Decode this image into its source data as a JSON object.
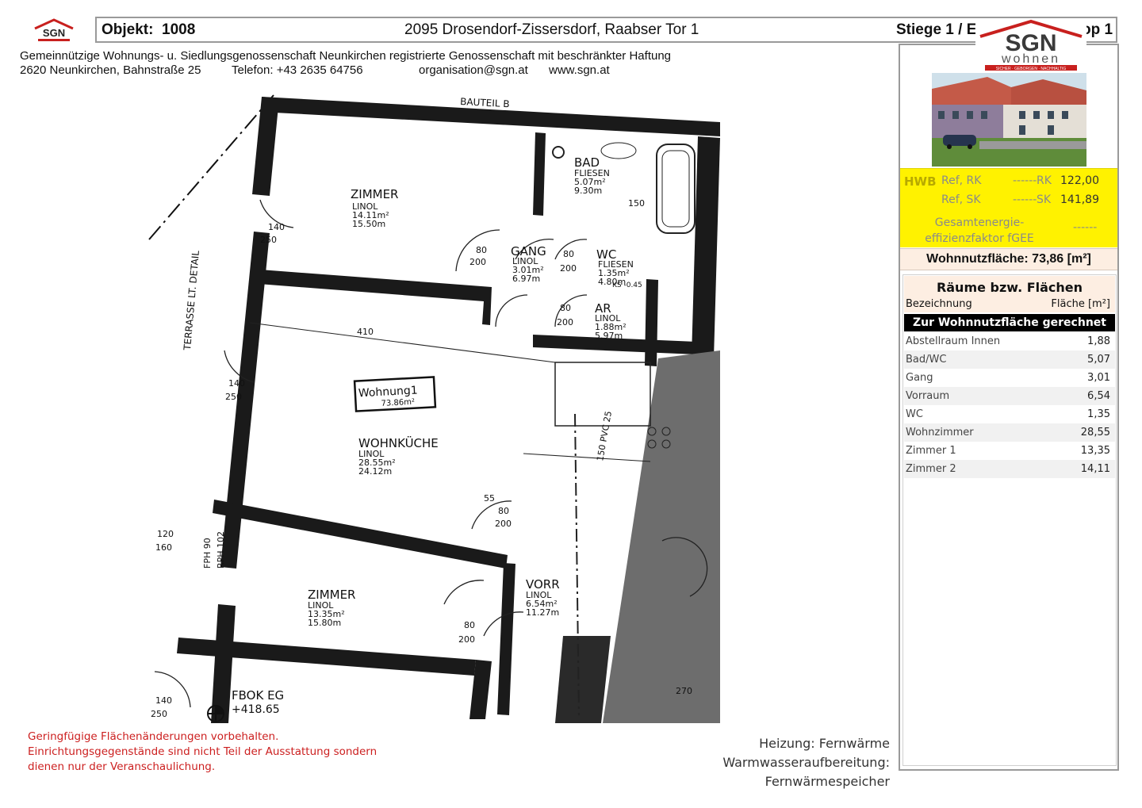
{
  "header": {
    "logo_small_text": "SGN",
    "objekt_label": "Objekt:",
    "objekt_number": "1008",
    "address": "2095 Drosendorf-Zissersdorf, Raabser Tor 1",
    "stiege": "Stiege 1 / Erdgeschoss / Top 1"
  },
  "company": {
    "name": "Gemeinnützige Wohnungs- u. Siedlungsgenossenschaft Neunkirchen registrierte Genossenschaft mit beschränkter Haftung",
    "street": "2620 Neunkirchen, Bahnstraße 25",
    "phone": "Telefon: +43 2635 64756",
    "email": "organisation@sgn.at",
    "web": "www.sgn.at"
  },
  "brand": {
    "logo_text": "SGN",
    "logo_sub": "wohnen",
    "logo_tagline": "SICHER · GEBORGEN · NACHHALTIG",
    "red": "#c8201e",
    "yellow": "#fff200"
  },
  "energy": {
    "hwb_label": "HWB",
    "ref_rk_label": "Ref, RK",
    "ref_rk_value": "------",
    "rk_label": "RK",
    "rk_value": "122,00",
    "ref_sk_label": "Ref, SK",
    "ref_sk_value": "------",
    "sk_label": "SK",
    "sk_value": "141,89",
    "fgee_line1": "Gesamtenergie-",
    "fgee_line2": "effizienzfaktor fGEE",
    "fgee_value": "------"
  },
  "wohnnutzflaeche": "Wohnnutzfläche: 73,86 [m²]",
  "rooms": {
    "title": "Räume bzw. Flächen",
    "col_name": "Bezeichnung",
    "col_area": "Fläche [m²]",
    "section": "Zur Wohnnutzfläche gerechnet",
    "items": [
      {
        "name": "Abstellraum Innen",
        "area": "1,88"
      },
      {
        "name": "Bad/WC",
        "area": "5,07"
      },
      {
        "name": "Gang",
        "area": "3,01"
      },
      {
        "name": "Vorraum",
        "area": "6,54"
      },
      {
        "name": "WC",
        "area": "1,35"
      },
      {
        "name": "Wohnzimmer",
        "area": "28,55"
      },
      {
        "name": "Zimmer 1",
        "area": "13,35"
      },
      {
        "name": "Zimmer 2",
        "area": "14,11"
      }
    ]
  },
  "plan": {
    "bauteil": "BAUTEIL B",
    "terrasse": "TERRASSE LT. DETAIL",
    "zimmer_top": {
      "name": "ZIMMER",
      "floor": "LINOL",
      "area": "14.11m²",
      "height": "15.50m"
    },
    "bad": {
      "name": "BAD",
      "floor": "FLIESEN",
      "area": "5.07m²",
      "height": "9.30m"
    },
    "gang": {
      "name": "GANG",
      "floor": "LINOL",
      "area": "3.01m²",
      "height": "6.97m"
    },
    "wc": {
      "name": "WC",
      "floor": "FLIESEN",
      "area": "1.35m²",
      "height": "4.80m"
    },
    "ar": {
      "name": "AR",
      "floor": "LINOL",
      "area": "1.88m²",
      "height": "5.97m"
    },
    "wohnung": {
      "name": "Wohnung1",
      "area": "73.86m²"
    },
    "wohnkueche": {
      "name": "WOHNKÜCHE",
      "floor": "LINOL",
      "area": "28.55m²",
      "height": "24.12m"
    },
    "zimmer_bottom": {
      "name": "ZIMMER",
      "floor": "LINOL",
      "area": "13.35m²",
      "height": "15.80m"
    },
    "vorr": {
      "name": "VORR",
      "floor": "LINOL",
      "area": "6.54m²",
      "height": "11.27m"
    },
    "fbok": "FBOK EG",
    "fbok_level": "+418.65",
    "dims": {
      "d140": "140",
      "d250": "250",
      "d80": "80",
      "d200": "200",
      "d410": "410",
      "d120": "120",
      "d160": "160",
      "d150": "150",
      "d270": "270",
      "d55": "55",
      "fph": "FPH 90",
      "rph": "RPH 102",
      "pvc": "150 PVC 25",
      "ks": "KS -0.45"
    }
  },
  "footer": {
    "disclaimer_1": "Geringfügige Flächenänderungen vorbehalten.",
    "disclaimer_2": "Einrichtungsgegenstände sind nicht Teil der Ausstattung sondern",
    "disclaimer_3": "dienen nur der Veranschaulichung.",
    "heating": "Heizung: Fernwärme",
    "hotwater": "Warmwasseraufbereitung: Fernwärmespeicher"
  }
}
